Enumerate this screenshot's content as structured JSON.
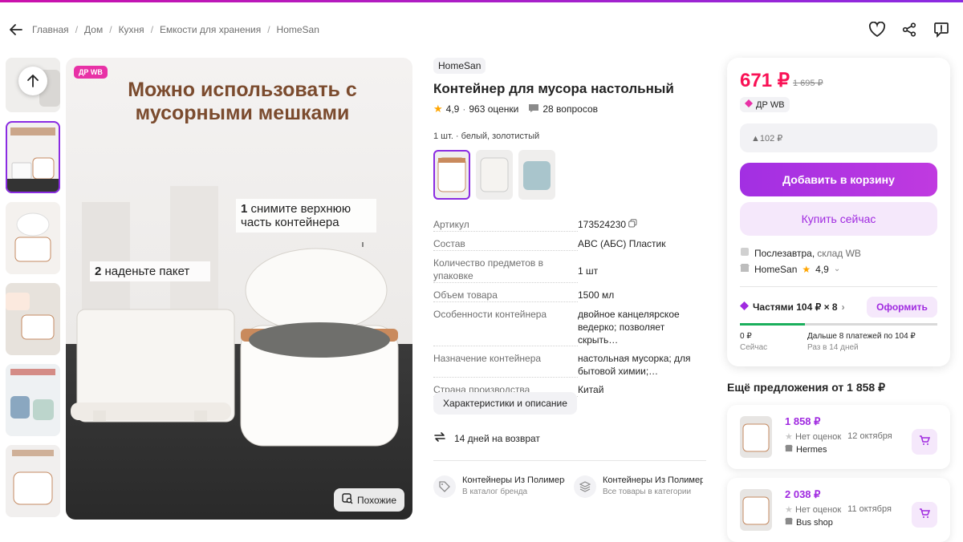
{
  "breadcrumb": {
    "items": [
      "Главная",
      "Дом",
      "Кухня",
      "Емкости для хранения",
      "HomeSan"
    ]
  },
  "gallery": {
    "badge": "ДР WB",
    "headline": "Можно использовать с мусорными мешками",
    "step1_num": "1",
    "step1": "снимите верхнюю часть контейнера",
    "step2_num": "2",
    "step2": "наденьте пакет",
    "similar_label": "Похожие"
  },
  "product": {
    "brand": "HomeSan",
    "title": "Контейнер для мусора настольный",
    "rating": "4,9",
    "reviews": "963 оценки",
    "questions": "28 вопросов",
    "variant": "1 шт. · белый, золотистый"
  },
  "specs": [
    {
      "k": "Артикул",
      "v": "173524230"
    },
    {
      "k": "Состав",
      "v": "ABC (АБС) Пластик"
    },
    {
      "k": "Количество предметов в упаковке",
      "v": "1 шт"
    },
    {
      "k": "Объем товара",
      "v": "1500 мл"
    },
    {
      "k": "Особенности контейнера",
      "v": "двойное канцелярское ведерко; позволяет скрыть…"
    },
    {
      "k": "Назначение контейнера",
      "v": "настольная мусорка; для бытовой химии;…"
    },
    {
      "k": "Страна производства",
      "v": "Китай"
    }
  ],
  "details_button": "Характеристики и описание",
  "return_text": "14 дней на возврат",
  "categories": [
    {
      "title": "Контейнеры Из Полимеров",
      "sub": "В каталог бренда"
    },
    {
      "title": "Контейнеры Из Полимеров",
      "sub": "Все товары в категории"
    }
  ],
  "buy_card": {
    "price": "671 ₽",
    "old_price": "1 695 ₽",
    "promo": "ДР WB",
    "wallet": "▲102 ₽",
    "add_to_cart": "Добавить в корзину",
    "buy_now": "Купить сейчас",
    "delivery_day": "Послезавтра,",
    "delivery_wh": "склад WB",
    "seller": "HomeSan",
    "seller_rating": "4,9",
    "installments": "Частями 104 ₽ × 8",
    "order_label": "Оформить",
    "installment_progress": 0.33,
    "now_amount": "0 ₽",
    "now_label": "Сейчас",
    "later_amount": "Дальше 8 платежей по 104 ₽",
    "later_label": "Раз в 14 дней"
  },
  "other_offers": {
    "heading": "Ещё предложения от 1 858 ₽",
    "items": [
      {
        "price": "1 858 ₽",
        "rating": "Нет оценок",
        "date": "12 октября",
        "seller": "Hermes"
      },
      {
        "price": "2 038 ₽",
        "rating": "Нет оценок",
        "date": "11 октября",
        "seller": "Bus shop"
      }
    ]
  },
  "colors": {
    "accent": "#a02ae0",
    "price": "#f91155",
    "promo": "#e831a6",
    "progress": "#1aaf5c"
  }
}
